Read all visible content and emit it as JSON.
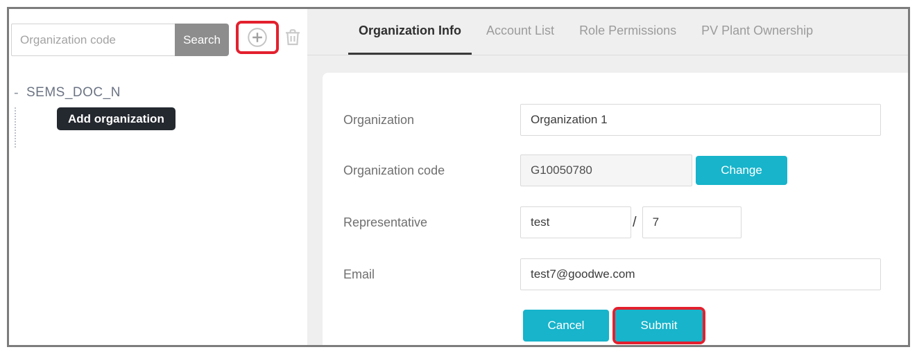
{
  "colors": {
    "accent_cyan": "#17b4cb",
    "annotation_red": "#e3202e",
    "tooltip_bg": "#24282f",
    "search_button_gray": "#8d8d8d"
  },
  "sidebar": {
    "search": {
      "placeholder": "Organization code",
      "button_label": "Search"
    },
    "add_icon": "plus-circle-icon",
    "delete_icon": "trash-icon",
    "tree": {
      "toggle_glyph": "-",
      "root_label": "SEMS_DOC_N"
    },
    "tooltip_label": "Add organization"
  },
  "tabs": [
    {
      "label": "Organization Info",
      "active": true
    },
    {
      "label": "Account List",
      "active": false
    },
    {
      "label": "Role Permissions",
      "active": false
    },
    {
      "label": "PV Plant Ownership",
      "active": false
    }
  ],
  "form": {
    "organization": {
      "label": "Organization",
      "value": "Organization 1"
    },
    "organization_code": {
      "label": "Organization code",
      "value": "G10050780",
      "change_button": "Change"
    },
    "representative": {
      "label": "Representative",
      "name_value": "test",
      "separator": "/",
      "number_value": "7"
    },
    "email": {
      "label": "Email",
      "value": "test7@goodwe.com"
    },
    "buttons": {
      "cancel": "Cancel",
      "submit": "Submit"
    }
  }
}
